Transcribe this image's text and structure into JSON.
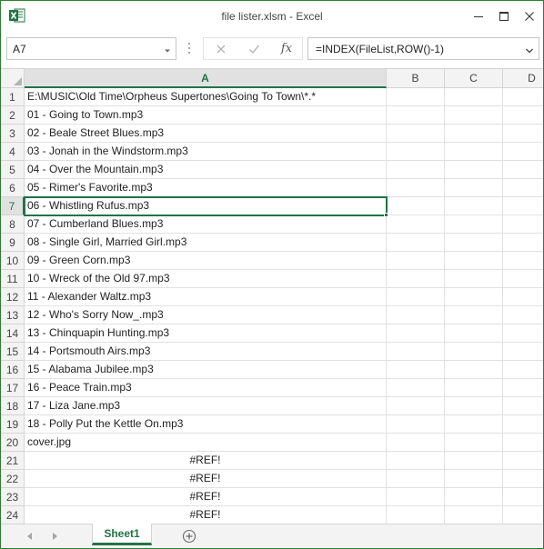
{
  "window": {
    "title": "file lister.xlsm - Excel",
    "app_icon_letter": "X"
  },
  "formula_bar": {
    "name_box": "A7",
    "formula": "=INDEX(FileList,ROW()-1)",
    "fx_label": "fx"
  },
  "columns": [
    "A",
    "B",
    "C",
    "D"
  ],
  "active_column": "A",
  "active_row": 7,
  "rows": [
    {
      "num": "1",
      "a": "E:\\MUSIC\\Old Time\\Orpheus Supertones\\Going To Town\\*.*"
    },
    {
      "num": "2",
      "a": "01 - Going to Town.mp3"
    },
    {
      "num": "3",
      "a": "02 - Beale Street Blues.mp3"
    },
    {
      "num": "4",
      "a": "03 - Jonah in the Windstorm.mp3"
    },
    {
      "num": "5",
      "a": "04 - Over the Mountain.mp3"
    },
    {
      "num": "6",
      "a": "05 - Rimer's Favorite.mp3"
    },
    {
      "num": "7",
      "a": "06 - Whistling Rufus.mp3"
    },
    {
      "num": "8",
      "a": "07 - Cumberland Blues.mp3"
    },
    {
      "num": "9",
      "a": "08 - Single Girl, Married Girl.mp3"
    },
    {
      "num": "10",
      "a": "09 - Green Corn.mp3"
    },
    {
      "num": "11",
      "a": "10 - Wreck of the Old 97.mp3"
    },
    {
      "num": "12",
      "a": "11 - Alexander Waltz.mp3"
    },
    {
      "num": "13",
      "a": "12 - Who's Sorry Now_.mp3"
    },
    {
      "num": "14",
      "a": "13 - Chinquapin Hunting.mp3"
    },
    {
      "num": "15",
      "a": "14 - Portsmouth Airs.mp3"
    },
    {
      "num": "16",
      "a": "15 - Alabama Jubilee.mp3"
    },
    {
      "num": "17",
      "a": "16 - Peace Train.mp3"
    },
    {
      "num": "18",
      "a": "17 - Liza Jane.mp3"
    },
    {
      "num": "19",
      "a": "18 - Polly Put the Kettle On.mp3"
    },
    {
      "num": "20",
      "a": "cover.jpg"
    },
    {
      "num": "21",
      "a": "#REF!",
      "error": true
    },
    {
      "num": "22",
      "a": "#REF!",
      "error": true
    },
    {
      "num": "23",
      "a": "#REF!",
      "error": true
    },
    {
      "num": "24",
      "a": "#REF!",
      "error": true
    }
  ],
  "sheet_tabs": [
    {
      "label": "Sheet1",
      "active": true
    }
  ],
  "colors": {
    "excel_green": "#217346",
    "window_border": "#2e7d32",
    "grid_line": "#e1e1e1",
    "header_bg": "#f3f3f3"
  }
}
